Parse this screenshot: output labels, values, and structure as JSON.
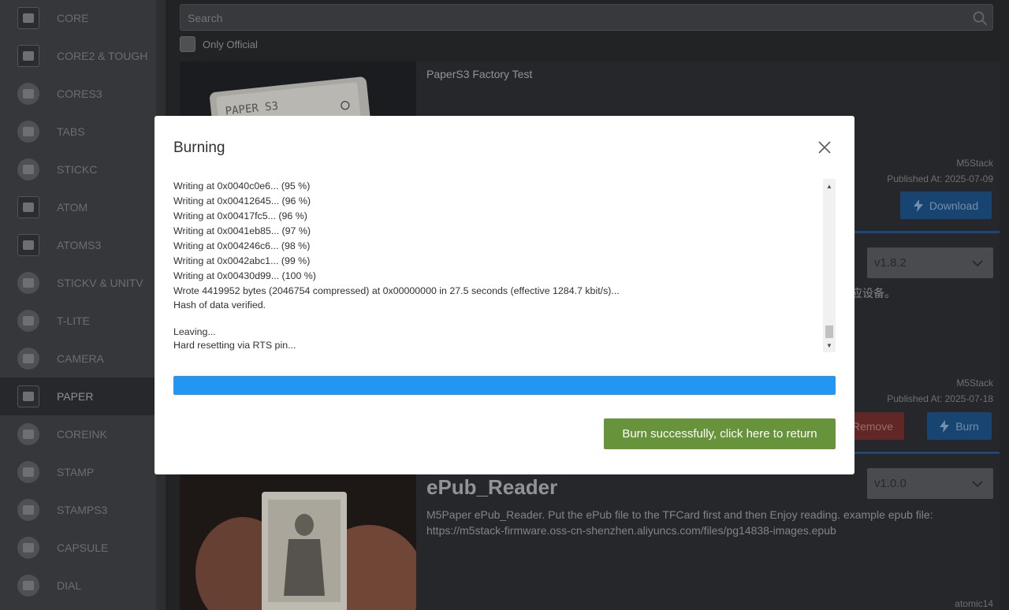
{
  "sidebar": {
    "items": [
      {
        "label": "CORE",
        "icon": "core-device-icon"
      },
      {
        "label": "CORE2 & TOUGH",
        "icon": "core2-device-icon"
      },
      {
        "label": "CORES3",
        "icon": "cores3-device-icon"
      },
      {
        "label": "TABS",
        "icon": "tab5-device-icon"
      },
      {
        "label": "STICKC",
        "icon": "stickc-device-icon"
      },
      {
        "label": "ATOM",
        "icon": "atom-device-icon"
      },
      {
        "label": "ATOMS3",
        "icon": "atoms3-device-icon"
      },
      {
        "label": "STICKV & UNITV",
        "icon": "stickv-device-icon"
      },
      {
        "label": "T-LITE",
        "icon": "tlite-device-icon"
      },
      {
        "label": "CAMERA",
        "icon": "camera-device-icon"
      },
      {
        "label": "PAPER",
        "icon": "paper-device-icon",
        "active": true
      },
      {
        "label": "COREINK",
        "icon": "coreink-device-icon"
      },
      {
        "label": "STAMP",
        "icon": "stamp-device-icon"
      },
      {
        "label": "STAMPS3",
        "icon": "stamps3-device-icon"
      },
      {
        "label": "CAPSULE",
        "icon": "capsule-device-icon"
      },
      {
        "label": "DIAL",
        "icon": "dial-device-icon"
      }
    ]
  },
  "main": {
    "search": {
      "placeholder": "Search"
    },
    "only_official_label": "Only Official",
    "cards": [
      {
        "title": "PaperS3 Factory Test",
        "image_text": "PAPER S3",
        "author": "M5Stack",
        "published": "Published At: 2025-07-09",
        "download_label": "Download"
      },
      {
        "version": "v1.8.2",
        "desc_fragment": "应设备。",
        "author": "M5Stack",
        "published": "Published At: 2025-07-18",
        "remove_label": "Remove",
        "burn_label": "Burn"
      },
      {
        "title": "ePub_Reader",
        "version": "v1.0.0",
        "desc_line1": "M5Paper ePub_Reader. Put the ePub file to the TFCard first and then Enjoy reading. example epub file:",
        "desc_line2": "https://m5stack-firmware.oss-cn-shenzhen.aliyuncs.com/files/pg14838-images.epub",
        "author": "atomic14"
      }
    ]
  },
  "modal": {
    "title": "Burning",
    "log_lines": [
      "Writing at 0x0040c0e6... (95 %)",
      "Writing at 0x00412645... (96 %)",
      "Writing at 0x00417fc5... (96 %)",
      "Writing at 0x0041eb85... (97 %)",
      "Writing at 0x004246c6... (98 %)",
      "Writing at 0x0042abc1... (99 %)",
      "Writing at 0x00430d99... (100 %)",
      "Wrote 4419952 bytes (2046754 compressed) at 0x00000000 in 27.5 seconds (effective 1284.7 kbit/s)...",
      "Hash of data verified.",
      "",
      "Leaving...",
      "Hard resetting via RTS pin..."
    ],
    "progress_percent": 100,
    "done_button_label": "Burn successfully, click here to return"
  },
  "colors": {
    "progress": "#2196f3",
    "success_button": "#67943a",
    "primary_button": "#1a4a7a",
    "danger_button": "#6a2a2a"
  }
}
